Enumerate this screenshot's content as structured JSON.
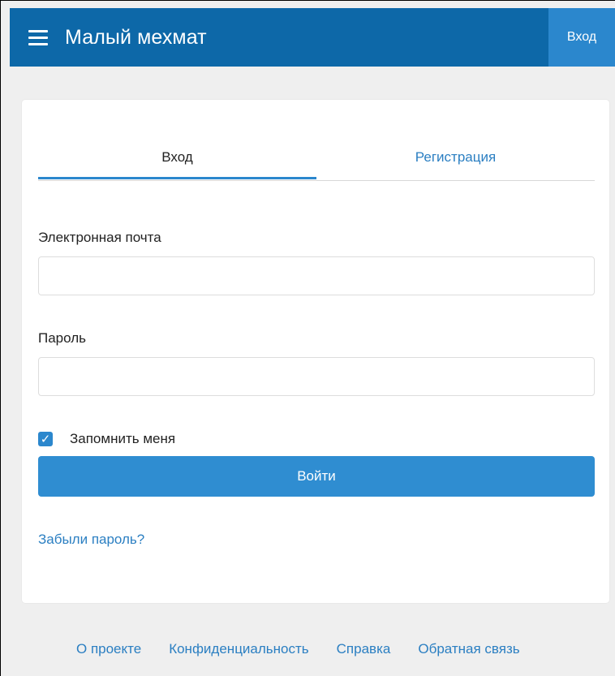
{
  "header": {
    "menu_icon": "menu-icon",
    "title": "Малый мехмат",
    "login_label": "Вход",
    "color": "#0d68a8",
    "button_color": "#2b87cd"
  },
  "auth": {
    "tabs": [
      {
        "label": "Вход"
      },
      {
        "label": "Регистрация"
      }
    ],
    "email_label": "Электронная почта",
    "email_value": "",
    "email_placeholder": "",
    "password_label": "Пароль",
    "password_value": "",
    "password_placeholder": "",
    "remember_checked": true,
    "remember_label": "Запомнить меня",
    "submit_label": "Войти",
    "forgot_label": "Забыли пароль?"
  },
  "footer": {
    "links": [
      "О проекте",
      "Конфиденциальность",
      "Справка",
      "Обратная связь"
    ]
  }
}
